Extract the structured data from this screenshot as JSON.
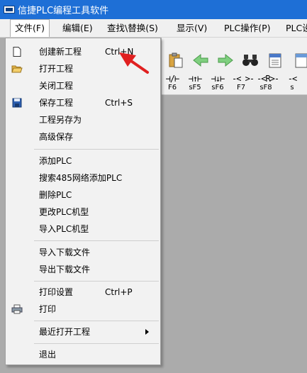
{
  "window": {
    "title": "信捷PLC编程工具软件"
  },
  "menubar": [
    {
      "label": "文件(F)"
    },
    {
      "label": "编辑(E)"
    },
    {
      "label": "查找\\替换(S)"
    },
    {
      "label": "显示(V)"
    },
    {
      "label": "PLC操作(P)"
    },
    {
      "label": "PLC设"
    }
  ],
  "toolbar": {
    "icons": [
      "paste-icon",
      "back-arrow-icon",
      "forward-arrow-icon",
      "find-binoculars-icon",
      "document-icon",
      "document2-icon"
    ],
    "ladder": [
      {
        "symbol": "⊣/⊢",
        "key": "F6"
      },
      {
        "symbol": "⊣↑⊢",
        "key": "sF5"
      },
      {
        "symbol": "⊣↓⊢",
        "key": "sF6"
      },
      {
        "symbol": "-< >-",
        "key": "F7"
      },
      {
        "symbol": "-<R>-",
        "key": "sF8"
      },
      {
        "symbol": "-<",
        "key": "s"
      }
    ]
  },
  "file_menu": {
    "items": [
      {
        "label": "创建新工程",
        "shortcut": "Ctrl+N",
        "icon": "new-file-icon"
      },
      {
        "label": "打开工程",
        "icon": "open-folder-icon"
      },
      {
        "label": "关闭工程"
      },
      {
        "label": "保存工程",
        "shortcut": "Ctrl+S",
        "icon": "save-disk-icon"
      },
      {
        "label": "工程另存为"
      },
      {
        "label": "高级保存"
      },
      {
        "label": "添加PLC"
      },
      {
        "label": "搜索485网络添加PLC"
      },
      {
        "label": "删除PLC"
      },
      {
        "label": "更改PLC机型"
      },
      {
        "label": "导入PLC机型"
      },
      {
        "label": "导入下载文件"
      },
      {
        "label": "导出下载文件"
      },
      {
        "label": "打印设置",
        "shortcut": "Ctrl+P"
      },
      {
        "label": "打印",
        "icon": "printer-icon"
      },
      {
        "label": "最近打开工程"
      },
      {
        "label": "退出"
      }
    ]
  },
  "colors": {
    "titlebar": "#1e6fd6",
    "workspace": "#ababab",
    "annotation_arrow": "#e02020"
  }
}
